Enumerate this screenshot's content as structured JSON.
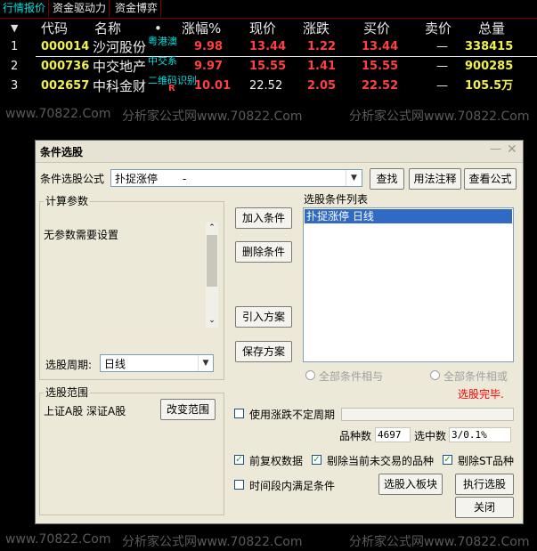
{
  "tabs": [
    "行情报价",
    "资金驱动力",
    "资金博弈"
  ],
  "header": {
    "arrow": "▼",
    "columns": [
      "代码",
      "名称",
      "•",
      "涨幅%",
      "现价",
      "涨跌",
      "买价",
      "卖价",
      "总量"
    ]
  },
  "rows": [
    {
      "index": "1",
      "code": "000014",
      "name": "沙河股份",
      "tag": "粤港澳",
      "pct": "9.98",
      "price": "13.44",
      "change": "1.22",
      "bid": "13.44",
      "ask": "—",
      "volume": "338415"
    },
    {
      "index": "2",
      "code": "000736",
      "name": "中交地产",
      "tag": "中交系",
      "pct": "9.97",
      "price": "15.55",
      "change": "1.41",
      "bid": "15.55",
      "ask": "—",
      "volume": "900285"
    },
    {
      "index": "3",
      "code": "002657",
      "name": "中科金财",
      "tag": "二维码识别",
      "tag_badge": "R",
      "pct": "10.01",
      "price": "22.52",
      "change": "2.05",
      "bid": "22.52",
      "ask": "—",
      "volume": "105.5万"
    }
  ],
  "watermark": {
    "left": "www.70822.Com",
    "right": "分析家公式网www.70822.Com"
  },
  "dialog": {
    "title": "条件选股",
    "formula_label": "条件选股公式",
    "formula_value": "扑捉涨停",
    "formula_dash": "-",
    "find_button": "查找",
    "usage_button": "用法注释",
    "view_formula_button": "查看公式",
    "params_group": "计算参数",
    "params_text": "无参数需要设置",
    "period_label": "选股周期:",
    "period_value": "日线",
    "add_condition_button": "加入条件",
    "delete_condition_button": "删除条件",
    "import_scheme_button": "引入方案",
    "save_scheme_button": "保存方案",
    "condition_list_label": "选股条件列表",
    "condition_item": "扑捉涨停  日线",
    "all_and_label": "全部条件相与",
    "all_or_label": "全部条件相或",
    "done_text": "选股完毕.",
    "range_group": "选股范围",
    "range_text": "上证A股 深证A股",
    "change_range_button": "改变范围",
    "uncertain_period_label": "使用涨跌不定周期",
    "stock_count_label": "品种数",
    "stock_count_value": "4697",
    "selected_count_label": "选中数",
    "selected_count_value": "3/0.1%",
    "prior_adjust_label": "前复权数据",
    "exclude_untraded_label": "剔除当前未交易的品种",
    "exclude_st_label": "剔除ST品种",
    "time_range_label": "时间段内满足条件",
    "into_block_button": "选股入板块",
    "execute_button": "执行选股",
    "close_button": "关闭"
  },
  "colors": {
    "up": "#ff4040",
    "code": "#f0f050",
    "tag": "#00e0e0",
    "selection": "#316ac5",
    "done": "#ff0000"
  }
}
